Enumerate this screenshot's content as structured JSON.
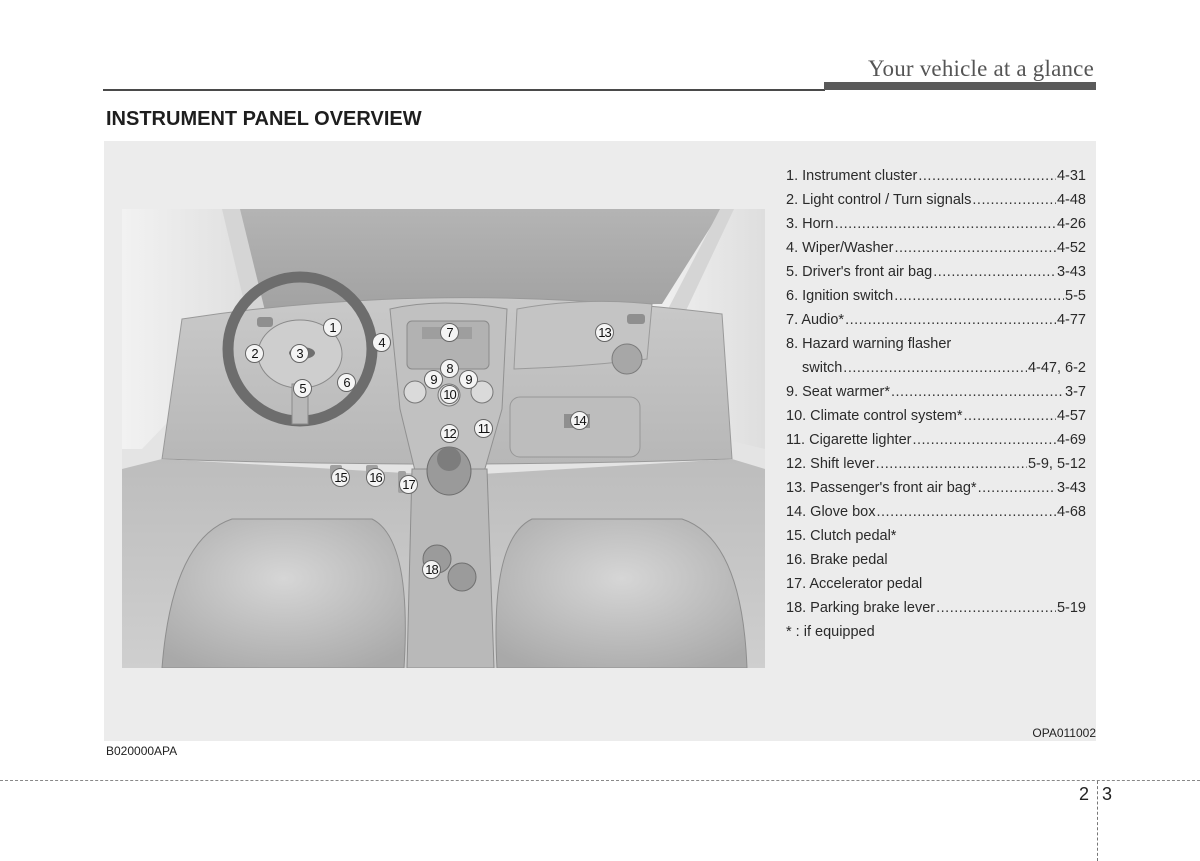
{
  "header": {
    "section_title": "Your vehicle at a glance"
  },
  "page": {
    "title": "INSTRUMENT PANEL OVERVIEW",
    "figure_code": "B020000APA",
    "image_code": "OPA011002",
    "chapter_number": "2",
    "page_number": "3"
  },
  "illustration": {
    "description": "Car interior dashboard illustration",
    "callouts": [
      "1",
      "2",
      "3",
      "4",
      "5",
      "6",
      "7",
      "8",
      "9",
      "9",
      "10",
      "11",
      "12",
      "13",
      "14",
      "15",
      "16",
      "17",
      "18"
    ]
  },
  "legend": {
    "items": [
      {
        "label": "1. Instrument cluster",
        "page": "4-31"
      },
      {
        "label": "2. Light control / Turn signals",
        "page": "4-48"
      },
      {
        "label": "3. Horn",
        "page": "4-26"
      },
      {
        "label": "4. Wiper/Washer",
        "page": "4-52"
      },
      {
        "label": "5. Driver's front air bag",
        "page": "3-43"
      },
      {
        "label": "6. Ignition switch",
        "page": "5-5"
      },
      {
        "label": "7. Audio*",
        "page": "4-77"
      },
      {
        "label": "8. Hazard warning flasher",
        "page": ""
      },
      {
        "label": "switch",
        "page": "4-47, 6-2"
      },
      {
        "label": "9. Seat warmer*",
        "page": "3-7"
      },
      {
        "label": "10. Climate control system*",
        "page": "4-57"
      },
      {
        "label": "11. Cigarette lighter",
        "page": "4-69"
      },
      {
        "label": "12. Shift lever",
        "page": "5-9, 5-12"
      },
      {
        "label": "13. Passenger's front air bag*",
        "page": "3-43"
      },
      {
        "label": "14. Glove box",
        "page": "4-68"
      },
      {
        "label": "15. Clutch pedal*",
        "page": ""
      },
      {
        "label": "16. Brake pedal",
        "page": ""
      },
      {
        "label": "17. Accelerator pedal",
        "page": ""
      },
      {
        "label": "18. Parking brake lever",
        "page": "5-19"
      }
    ],
    "footnote": "* : if equipped"
  }
}
